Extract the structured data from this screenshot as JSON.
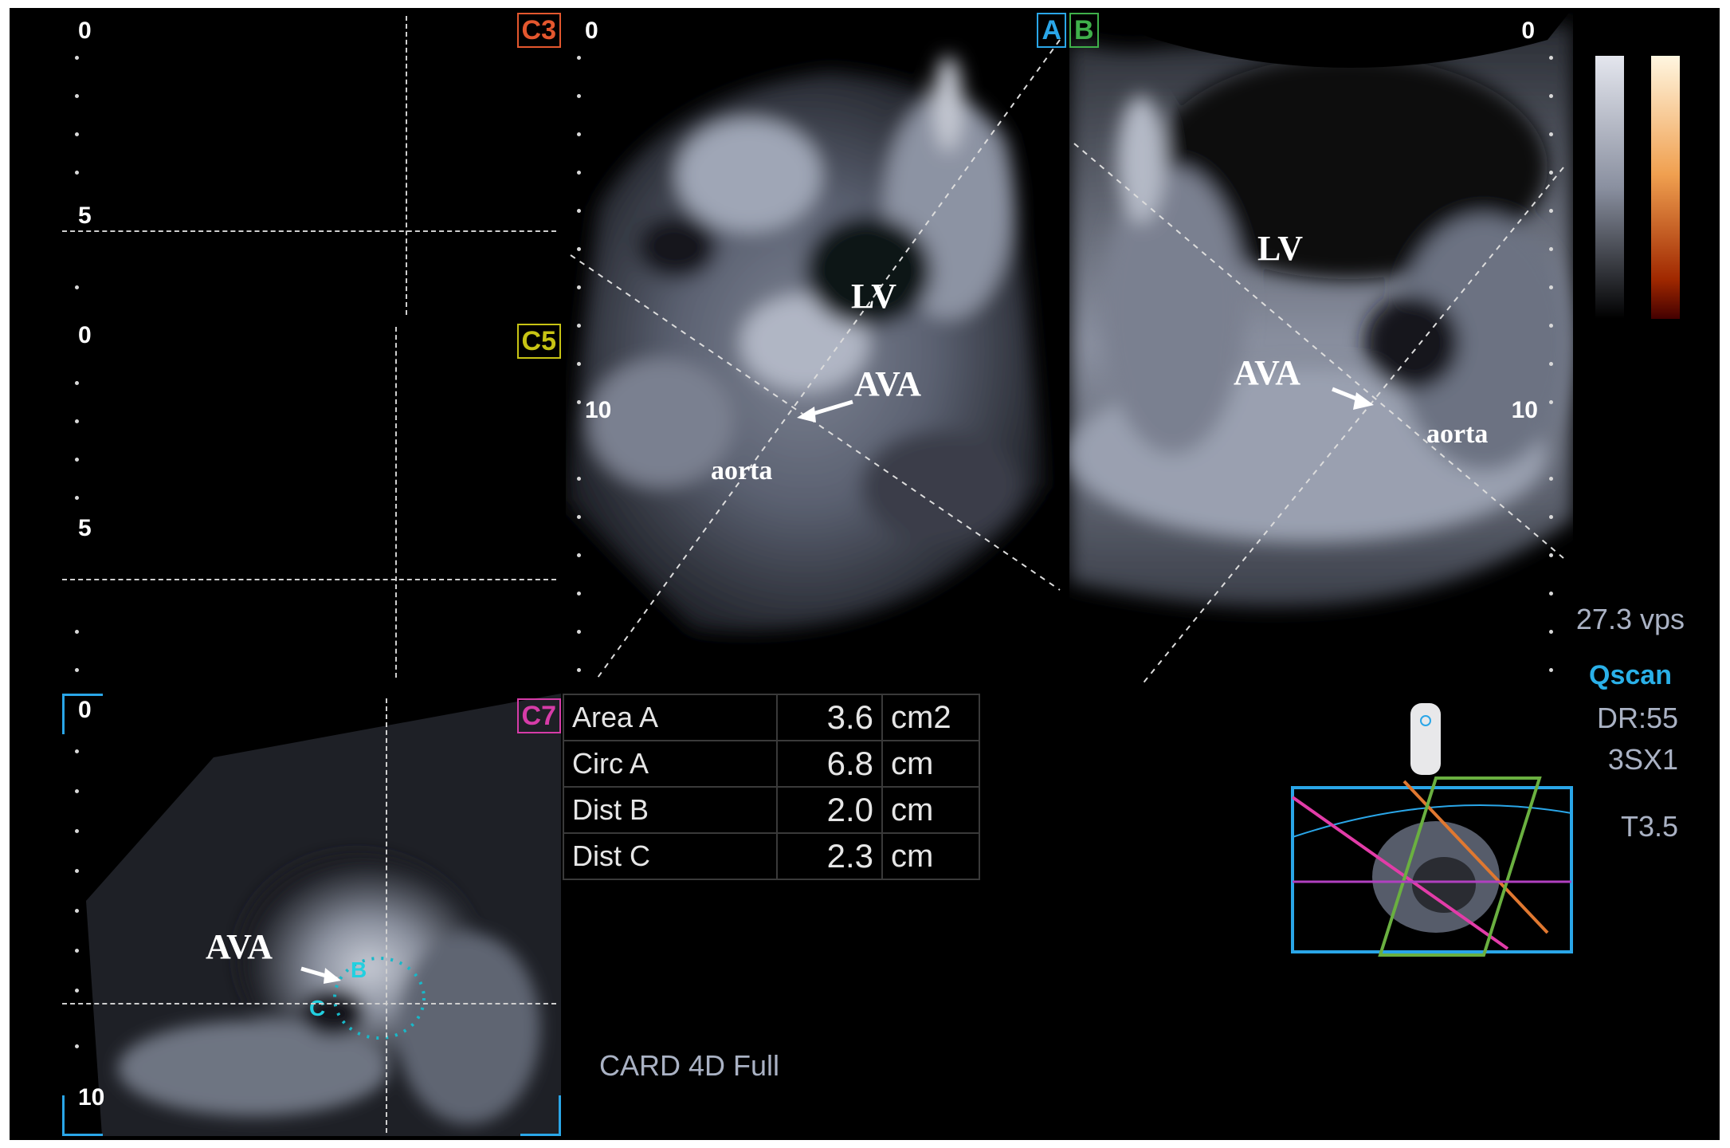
{
  "panes": {
    "c3": {
      "tag": "C3",
      "color": "#e4572e",
      "ticks": [
        "0",
        "5"
      ]
    },
    "c5": {
      "tag": "C5",
      "color": "#c8c414",
      "ticks": [
        "0",
        "5"
      ]
    },
    "c7": {
      "tag": "C7",
      "color": "#d63ca8",
      "ticks": [
        "0",
        "10"
      ],
      "annotation": "AVA",
      "markers": [
        "B",
        "C"
      ]
    },
    "a": {
      "tag": "A",
      "color": "#2aa6e8",
      "ticks": [
        "0",
        "10"
      ],
      "annotations": {
        "lv": "LV",
        "ava": "AVA",
        "aorta": "aorta"
      }
    },
    "b": {
      "tag": "B",
      "color": "#3fb04a",
      "ticks": [
        "0",
        "10"
      ],
      "annotations": {
        "lv": "LV",
        "ava": "AVA",
        "aorta": "aorta"
      }
    }
  },
  "measurements": [
    {
      "label": "Area A",
      "value": "3.6",
      "unit": "cm2"
    },
    {
      "label": "Circ A",
      "value": "6.8",
      "unit": "cm"
    },
    {
      "label": "Dist B",
      "value": "2.0",
      "unit": "cm"
    },
    {
      "label": "Dist C",
      "value": "2.3",
      "unit": "cm"
    }
  ],
  "status": {
    "vps": "27.3 vps",
    "mode": "Qscan",
    "dr": "DR:55",
    "probe": "3SX1",
    "tis": "T3.5"
  },
  "preset": "CARD 4D Full"
}
